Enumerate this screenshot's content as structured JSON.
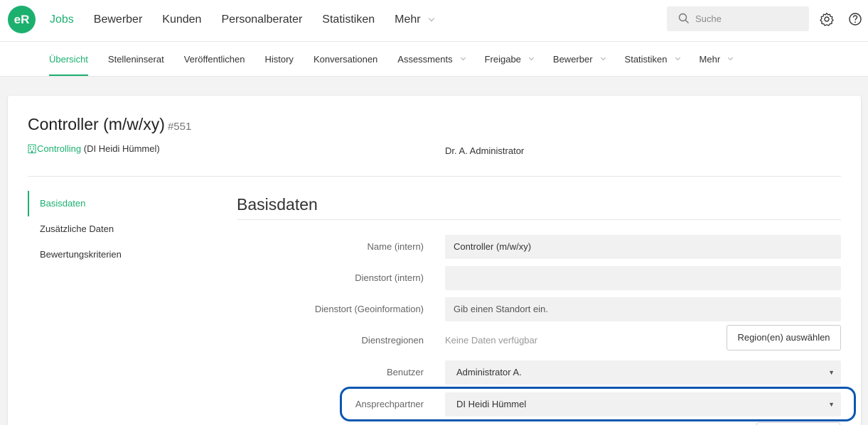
{
  "app": {
    "logo_text": "eR"
  },
  "topnav": {
    "items": [
      {
        "label": "Jobs",
        "active": true
      },
      {
        "label": "Bewerber"
      },
      {
        "label": "Kunden"
      },
      {
        "label": "Personalberater"
      },
      {
        "label": "Statistiken"
      },
      {
        "label": "Mehr",
        "dropdown": true
      }
    ],
    "search_placeholder": "Suche",
    "icons": [
      "search-icon",
      "gear-icon",
      "help-icon"
    ]
  },
  "subnav": {
    "items": [
      {
        "label": "Übersicht",
        "active": true
      },
      {
        "label": "Stelleninserat"
      },
      {
        "label": "Veröffentlichen"
      },
      {
        "label": "History"
      },
      {
        "label": "Konversationen"
      },
      {
        "label": "Assessments",
        "dropdown": true
      },
      {
        "label": "Freigabe",
        "dropdown": true
      },
      {
        "label": "Bewerber",
        "dropdown": true
      },
      {
        "label": "Statistiken",
        "dropdown": true
      },
      {
        "label": "Mehr",
        "dropdown": true
      }
    ]
  },
  "job": {
    "title": "Controller (m/w/xy)",
    "number": "#551",
    "department": "Controlling",
    "contact": "(DI Heidi Hümmel)",
    "owner": "Dr. A. Administrator"
  },
  "sidebar": {
    "items": [
      {
        "label": "Basisdaten",
        "active": true
      },
      {
        "label": "Zusätzliche Daten"
      },
      {
        "label": "Bewertungskriterien"
      }
    ]
  },
  "form": {
    "section_title": "Basisdaten",
    "name_label": "Name (intern)",
    "name_value": "Controller (m/w/xy)",
    "dienstort_label": "Dienstort (intern)",
    "dienstort_value": "",
    "geo_label": "Dienstort (Geoinformation)",
    "geo_value": "Gib einen Standort ein.",
    "regionen_label": "Dienstregionen",
    "regionen_empty": "Keine Daten verfügbar",
    "regionen_button": "Region(en) auswählen",
    "benutzer_label": "Benutzer",
    "benutzer_value": "Administrator A.",
    "ansprech_label": "Ansprechpartner",
    "ansprech_value": "DI Heidi Hümmel"
  },
  "colors": {
    "accent": "#1cb06f",
    "highlight": "#0a56b0"
  }
}
